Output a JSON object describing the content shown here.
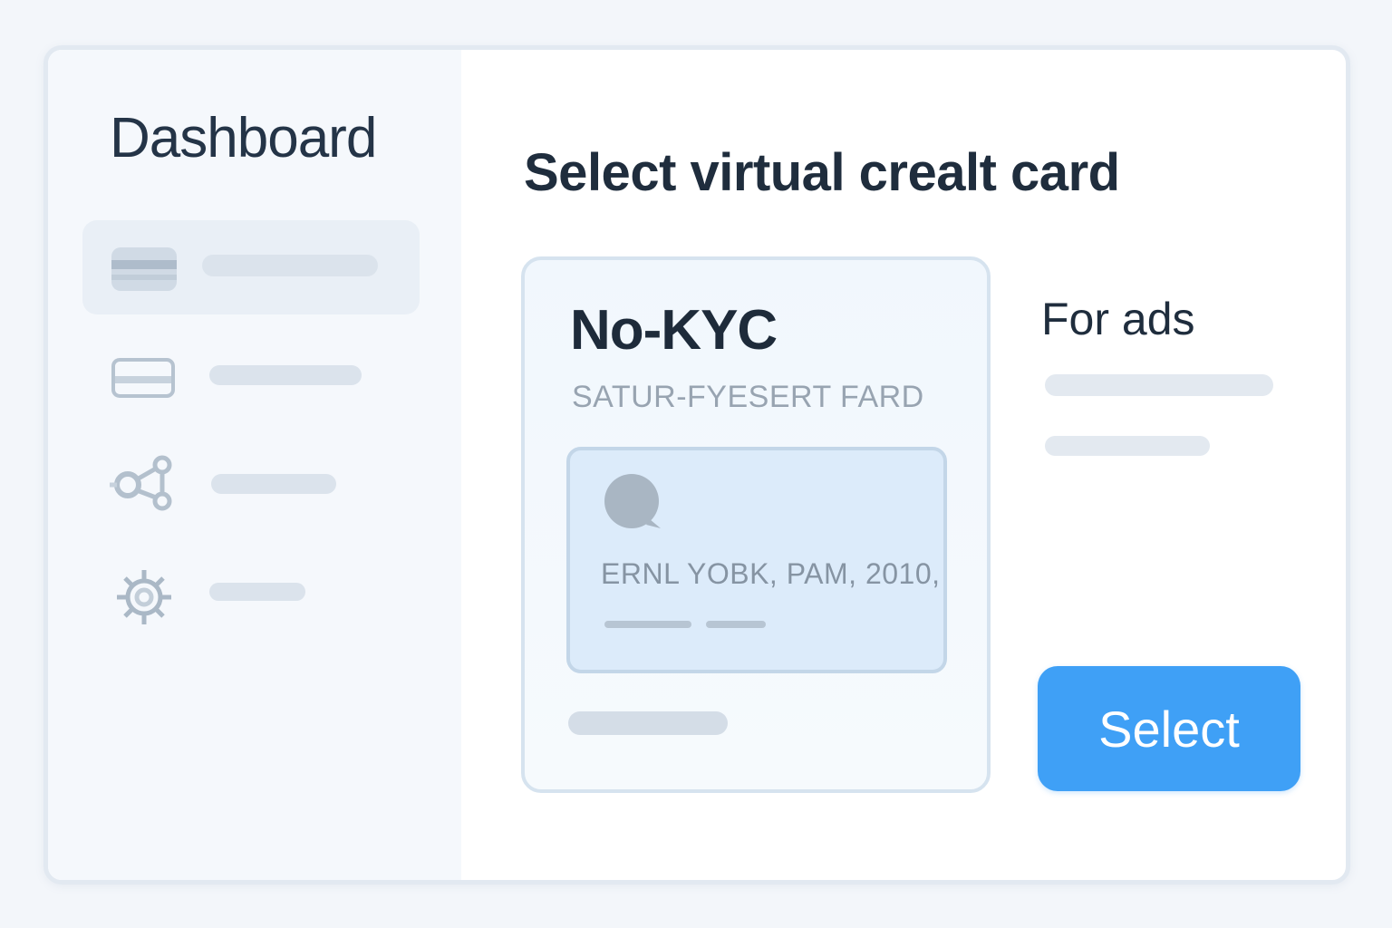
{
  "sidebar": {
    "title": "Dashboard",
    "items": [
      {
        "icon": "credit-card-icon",
        "active": true
      },
      {
        "icon": "card-icon",
        "active": false
      },
      {
        "icon": "network-icon",
        "active": false
      },
      {
        "icon": "gear-icon",
        "active": false
      }
    ]
  },
  "main": {
    "title": "Select virtual crealt card",
    "primary_option": {
      "title": "No-KYC",
      "subtitle": "SATUR-FYESERT FARD",
      "card": {
        "icon": "chat-bubble-icon",
        "text": "ERNL YOBK, PAM, 2010,"
      }
    },
    "secondary_option": {
      "title": "For ads"
    },
    "select_label": "Select"
  },
  "colors": {
    "accent": "#3fa0f6",
    "background": "#f3f6fa",
    "sidebar_bg": "#f5f8fc",
    "card_bg": "#dcebfa"
  }
}
